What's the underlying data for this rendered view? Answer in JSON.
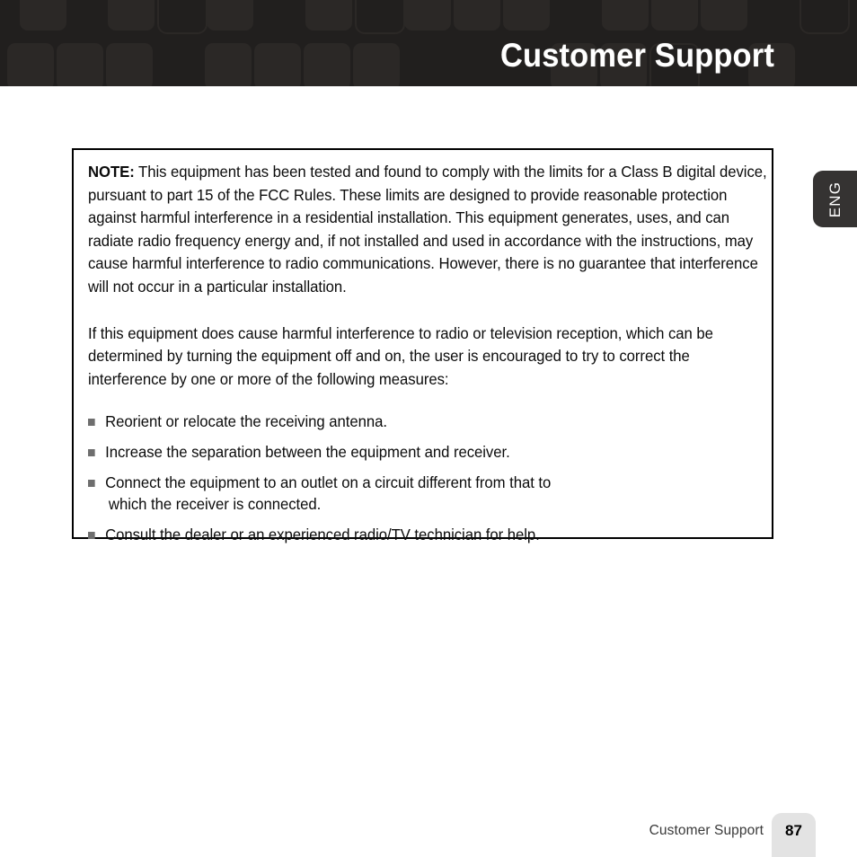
{
  "header": {
    "title": "Customer Support",
    "background_color": "#211f1e",
    "pattern_color": "#2b2826",
    "title_color": "#ffffff"
  },
  "side_tab": {
    "label": "ENG",
    "background_color": "#353332",
    "text_color": "#ffffff"
  },
  "note_box": {
    "border_color": "#000000",
    "paragraph_1_label": "NOTE:",
    "paragraph_1": " This equipment has been tested and found to comply with the limits for a Class B digital device, pursuant to part 15 of the FCC Rules. These limits are designed to provide reasonable protection against harmful interference in a residential installation. This equipment generates, uses, and can radiate radio frequency energy and, if not installed and used in accordance with the instructions, may cause harmful interference to radio communications. However, there is no guarantee that interference will not occur in a particular installation.",
    "paragraph_2": "If this equipment does cause harmful interference to radio or television reception, which can be determined by turning the equipment off and on, the user is encouraged to try to correct the interference by one or more of the following measures:",
    "bullets": [
      {
        "text": "Reorient or relocate the receiving antenna.",
        "continuation": ""
      },
      {
        "text": "Increase the separation between the equipment and receiver.",
        "continuation": ""
      },
      {
        "text": "Connect the equipment to an outlet on a circuit different from that to",
        "continuation": "which the receiver is connected."
      },
      {
        "text": "Consult the dealer or an experienced radio/TV technician for help.",
        "continuation": ""
      }
    ],
    "bullet_marker_color": "#6e6e6e"
  },
  "footer": {
    "label": "Customer Support",
    "page_number": "87",
    "badge_color": "#e3e3e3",
    "label_color": "#3a3a3a"
  }
}
